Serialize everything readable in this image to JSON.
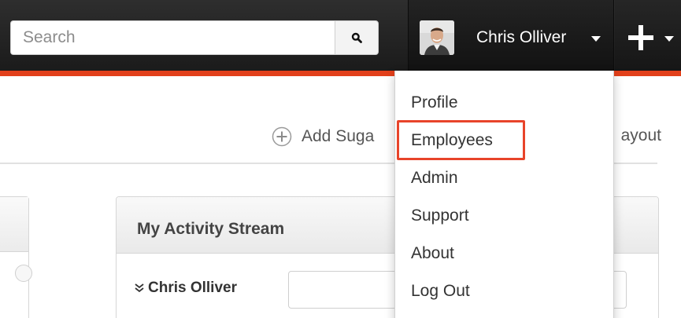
{
  "header": {
    "search": {
      "placeholder": "Search",
      "value": ""
    },
    "search_icon": "search-icon",
    "user": {
      "name": "Chris Olliver",
      "avatar": "avatar-photo"
    },
    "quick_create_icon": "plus-icon",
    "accent_color": "#e2401b"
  },
  "user_menu": {
    "items": [
      {
        "label": "Profile"
      },
      {
        "label": "Employees",
        "highlighted": true
      },
      {
        "label": "Admin"
      },
      {
        "label": "Support"
      },
      {
        "label": "About"
      },
      {
        "label": "Log Out"
      }
    ],
    "highlight_color": "#e8442a"
  },
  "toolbar": {
    "add_sugarlet_label": "Add Suga",
    "edit_layout_label": "ayout"
  },
  "dashlets": {
    "activity": {
      "title": "My Activity Stream",
      "stream_user": "Chris Olliver",
      "post_value": ""
    }
  }
}
